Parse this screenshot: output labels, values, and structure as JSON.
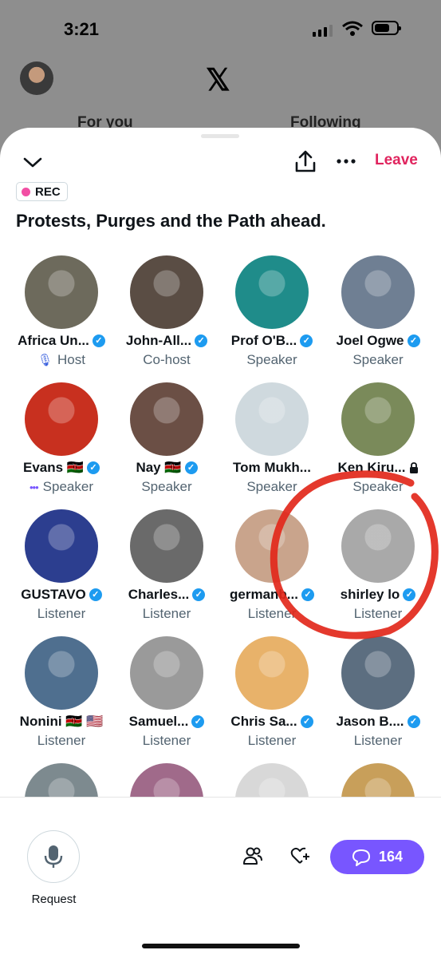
{
  "status_bar": {
    "time": "3:21"
  },
  "background": {
    "tabs": [
      "For you",
      "Following"
    ]
  },
  "header": {
    "leave_label": "Leave"
  },
  "space": {
    "rec_label": "REC",
    "title": "Protests, Purges and the Path ahead."
  },
  "participants": [
    {
      "name": "Africa Un...",
      "role": "Host",
      "verified": true,
      "role_icon": "mic-off-icon",
      "color": "#6d6a5c"
    },
    {
      "name": "John-All...",
      "role": "Co-host",
      "verified": true,
      "color": "#5a4d44"
    },
    {
      "name": "Prof O'B...",
      "role": "Speaker",
      "verified": true,
      "color": "#1f8c8a"
    },
    {
      "name": "Joel Ogwe",
      "role": "Speaker",
      "verified": true,
      "color": "#6f7f93"
    },
    {
      "name": "Evans 🇰🇪",
      "role": "Speaker",
      "verified": true,
      "role_icon": "speaking-dots-icon",
      "color": "#c8301f"
    },
    {
      "name": "Nay 🇰🇪",
      "role": "Speaker",
      "verified": true,
      "color": "#6b4f45"
    },
    {
      "name": "Tom Mukh...",
      "role": "Speaker",
      "verified": false,
      "color": "#cfd9de"
    },
    {
      "name": "Ken Kiru...",
      "role": "Speaker",
      "verified": false,
      "lock": true,
      "color": "#7a8a5a"
    },
    {
      "name": "GUSTAVO",
      "role": "Listener",
      "verified": true,
      "color": "#2c3e8f"
    },
    {
      "name": "Charles...",
      "role": "Listener",
      "verified": true,
      "color": "#6a6a6a"
    },
    {
      "name": "germanb...",
      "role": "Listener",
      "verified": true,
      "color": "#c9a48c"
    },
    {
      "name": "shirley lo",
      "role": "Listener",
      "verified": true,
      "color": "#a9a9a9"
    },
    {
      "name": "Nonini 🇰🇪 🇺🇸",
      "role": "Listener",
      "verified": false,
      "color": "#4f6f8f"
    },
    {
      "name": "Samuel...",
      "role": "Listener",
      "verified": true,
      "color": "#9a9a9a"
    },
    {
      "name": "Chris Sa...",
      "role": "Listener",
      "verified": true,
      "color": "#e8b26a"
    },
    {
      "name": "Jason B....",
      "role": "Listener",
      "verified": true,
      "color": "#5c6e80"
    },
    {
      "name": "",
      "role": "",
      "verified": false,
      "color": "#7d8a8f"
    },
    {
      "name": "",
      "role": "",
      "verified": false,
      "color": "#a06a8a"
    },
    {
      "name": "",
      "role": "",
      "verified": false,
      "color": "#d8d8d8"
    },
    {
      "name": "",
      "role": "",
      "verified": false,
      "color": "#c89f5a"
    }
  ],
  "footer": {
    "request_label": "Request",
    "comment_count": "164"
  },
  "colors": {
    "accent": "#7856ff",
    "leave": "#e0245e",
    "verified": "#1d9bf0",
    "rec_dot": "#f24fa4"
  }
}
